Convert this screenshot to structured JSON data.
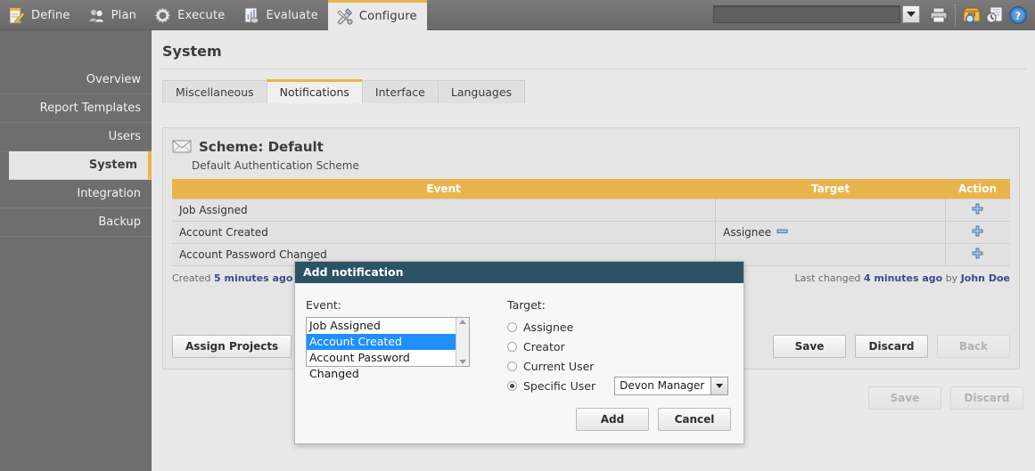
{
  "topnav": {
    "items": [
      {
        "label": "Define",
        "icon": "notepad-pencil-icon",
        "active": false
      },
      {
        "label": "Plan",
        "icon": "people-icon",
        "active": false
      },
      {
        "label": "Execute",
        "icon": "gear-icon",
        "active": false
      },
      {
        "label": "Evaluate",
        "icon": "chart-document-icon",
        "active": false
      },
      {
        "label": "Configure",
        "icon": "tools-icon",
        "active": true
      }
    ],
    "search_value": "",
    "search_placeholder": "",
    "tools": [
      {
        "icon": "dropdown-arrow-icon"
      },
      {
        "icon": "printer-icon"
      },
      {
        "icon": "archive-search-icon"
      },
      {
        "icon": "history-document-icon"
      },
      {
        "icon": "help-icon"
      }
    ]
  },
  "sidebar": {
    "items": [
      {
        "label": "Overview",
        "selected": false
      },
      {
        "label": "Report Templates",
        "selected": false
      },
      {
        "label": "Users",
        "selected": false
      },
      {
        "label": "System",
        "selected": true
      },
      {
        "label": "Integration",
        "selected": false
      },
      {
        "label": "Backup",
        "selected": false
      }
    ]
  },
  "page": {
    "title": "System",
    "tabs": [
      {
        "label": "Miscellaneous",
        "active": false
      },
      {
        "label": "Notifications",
        "active": true
      },
      {
        "label": "Interface",
        "active": false
      },
      {
        "label": "Languages",
        "active": false
      }
    ]
  },
  "scheme": {
    "icon": "envelope-icon",
    "title": "Scheme: Default",
    "subtitle": "Default Authentication Scheme"
  },
  "table": {
    "headers": [
      "Event",
      "Target",
      "Action"
    ],
    "rows": [
      {
        "event": "Job Assigned",
        "target": "",
        "target_icon": "",
        "action_icon": "plus-icon"
      },
      {
        "event": "Account Created",
        "target": "Assignee",
        "target_icon": "minus-icon",
        "action_icon": "plus-icon"
      },
      {
        "event": "Account Password Changed",
        "target": "",
        "target_icon": "",
        "action_icon": "plus-icon"
      }
    ]
  },
  "audit": {
    "created_prefix": "Created",
    "created_time": "5 minutes ago",
    "created_by_word": "by",
    "created_user": "John Doe",
    "changed_prefix": "Last changed",
    "changed_time": "4 minutes ago",
    "changed_by_word": "by",
    "changed_user": "John Doe"
  },
  "panel_buttons": {
    "assign_projects": "Assign Projects",
    "save": "Save",
    "discard": "Discard",
    "back": "Back"
  },
  "outer_buttons": {
    "save": "Save",
    "discard": "Discard"
  },
  "modal": {
    "title": "Add notification",
    "event_label": "Event:",
    "event_options": [
      {
        "label": "Job Assigned",
        "selected": false
      },
      {
        "label": "Account Created",
        "selected": true
      },
      {
        "label": "Account Password Changed",
        "selected": false
      }
    ],
    "target_label": "Target:",
    "target_options": [
      {
        "label": "Assignee",
        "selected": false
      },
      {
        "label": "Creator",
        "selected": false
      },
      {
        "label": "Current User",
        "selected": false
      },
      {
        "label": "Specific User",
        "selected": true
      }
    ],
    "specific_user_value": "Devon Manager",
    "add_button": "Add",
    "cancel_button": "Cancel"
  },
  "colors": {
    "accent_orange": "#e9b44c",
    "modal_header": "#2c5365",
    "selection_blue": "#1e90ff",
    "topbar_gray": "#707070",
    "sidebar_gray": "#6e6e6e",
    "link_blue": "#3a4a8c"
  }
}
